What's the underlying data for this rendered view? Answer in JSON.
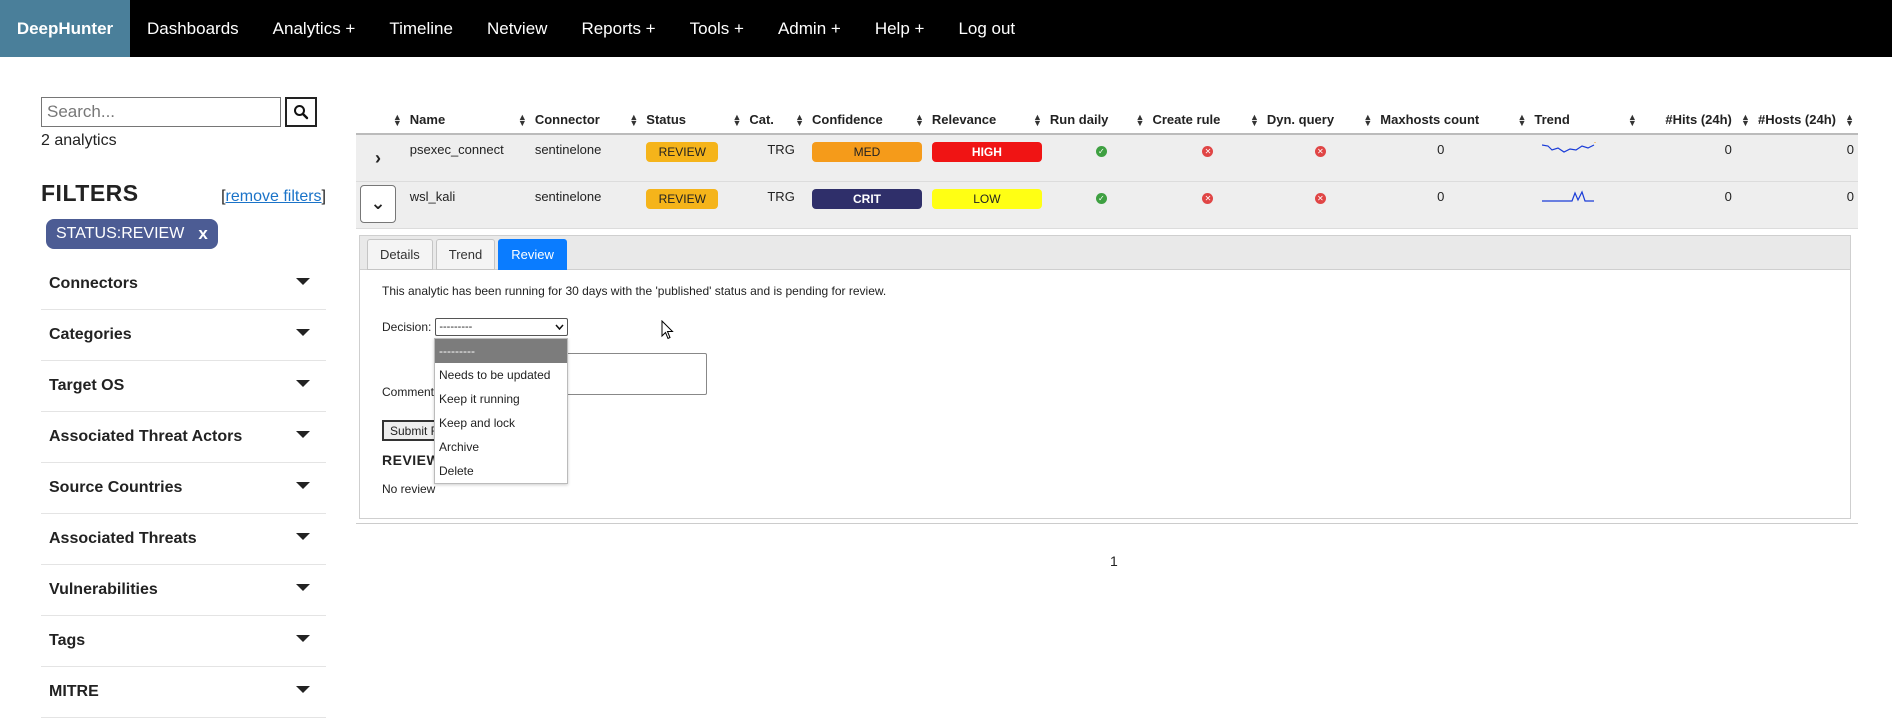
{
  "navbar": {
    "brand": "DeepHunter",
    "items": [
      "Dashboards",
      "Analytics +",
      "Timeline",
      "Netview",
      "Reports +",
      "Tools +",
      "Admin +",
      "Help +",
      "Log out"
    ]
  },
  "sidebar": {
    "search_placeholder": "Search...",
    "count_text": "2 analytics",
    "filters_title": "FILTERS",
    "remove_filters_open": "[",
    "remove_filters_label": "remove filters",
    "remove_filters_close": "]",
    "active_chip": "STATUS:REVIEW",
    "chip_close": "x",
    "filters": [
      "Connectors",
      "Categories",
      "Target OS",
      "Associated Threat Actors",
      "Source Countries",
      "Associated Threats",
      "Vulnerabilities",
      "Tags",
      "MITRE"
    ]
  },
  "table": {
    "columns": [
      "Name",
      "Connector",
      "Status",
      "Cat.",
      "Confidence",
      "Relevance",
      "Run daily",
      "Create rule",
      "Dyn. query",
      "Maxhosts count",
      "Trend",
      "#Hits (24h)",
      "#Hosts (24h)"
    ],
    "rows": [
      {
        "expander": "›",
        "name": "psexec_connect",
        "connector": "sentinelone",
        "status": "REVIEW",
        "cat": "TRG",
        "confidence": "MED",
        "relevance": "HIGH",
        "maxhosts": "0",
        "hits": "0",
        "hosts": "0"
      },
      {
        "expander": "⌄",
        "name": "wsl_kali",
        "connector": "sentinelone",
        "status": "REVIEW",
        "cat": "TRG",
        "confidence": "CRIT",
        "relevance": "LOW",
        "maxhosts": "0",
        "hits": "0",
        "hosts": "0"
      }
    ]
  },
  "panel": {
    "tabs": [
      "Details",
      "Trend",
      "Review"
    ],
    "active_tab": "Review",
    "message": "This analytic has been running for 30 days with the 'published' status and is pending for review.",
    "decision_label": "Decision:",
    "decision_value": "---------",
    "comment_label": "Comment",
    "submit_label": "Submit R",
    "review_heading": "REVIEW",
    "no_review": "No review"
  },
  "dropdown": {
    "options": [
      "---------",
      "Needs to be updated",
      "Keep it running",
      "Keep and lock",
      "Archive",
      "Delete"
    ],
    "selected": "---------"
  },
  "pagination": {
    "current": "1"
  },
  "colors": {
    "brand_bg": "#4a7f9a",
    "review": "#f5b41a",
    "med": "#f59b1a",
    "high": "#f01414",
    "crit": "#2f2f6a",
    "low": "#ffff14",
    "active_tab": "#0a7cff",
    "chip": "#4c5c94"
  }
}
